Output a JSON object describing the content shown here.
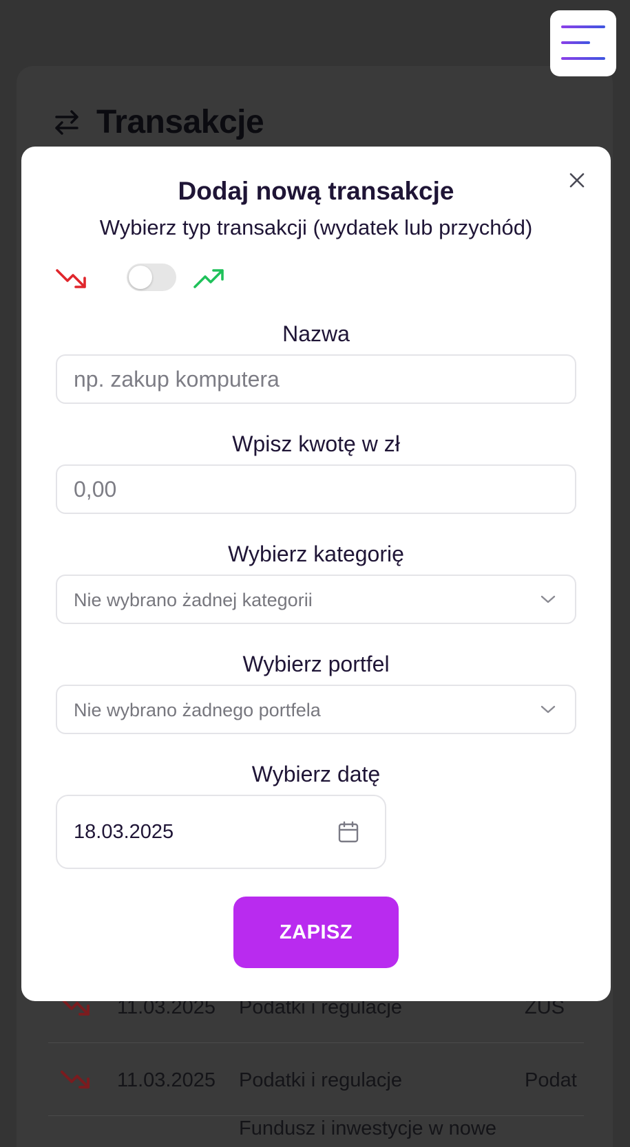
{
  "page": {
    "title": "Transakcje",
    "title_icon": "arrows-left-right-icon"
  },
  "menu_button": {
    "icon": "hamburger-menu-icon"
  },
  "background_rows": [
    {
      "icon": "trending-down-icon",
      "date": "11.03.2025",
      "category": "Podatki i regulacje",
      "name": "ZUS"
    },
    {
      "icon": "trending-down-icon",
      "date": "11.03.2025",
      "category": "Podatki i regulacje",
      "name": "Podat"
    },
    {
      "icon": "trending-up-icon",
      "date": "",
      "category": "Fundusz i inwestycje w nowe",
      "name": ""
    }
  ],
  "modal": {
    "title": "Dodaj nową transakcje",
    "subtitle": "Wybierz typ transakcji (wydatek lub przychód)",
    "close_icon": "close-icon",
    "type_toggle": {
      "expense_icon": "trending-down-icon",
      "income_icon": "trending-up-icon",
      "selected": "expense"
    },
    "name_field": {
      "label": "Nazwa",
      "placeholder": "np. zakup komputera",
      "value": ""
    },
    "amount_field": {
      "label": "Wpisz kwotę w zł",
      "placeholder": "0,00",
      "value": ""
    },
    "category_field": {
      "label": "Wybierz kategorię",
      "selected": "Nie wybrano żadnej kategorii"
    },
    "wallet_field": {
      "label": "Wybierz portfel",
      "selected": "Nie wybrano żadnego portfela"
    },
    "date_field": {
      "label": "Wybierz datę",
      "value": "18.03.2025"
    },
    "save_label": "ZAPISZ"
  },
  "colors": {
    "overlay": "#343434",
    "accent": "#b92bef",
    "expense": "#e0262c",
    "income": "#1fc15a",
    "text": "#1f1536"
  }
}
